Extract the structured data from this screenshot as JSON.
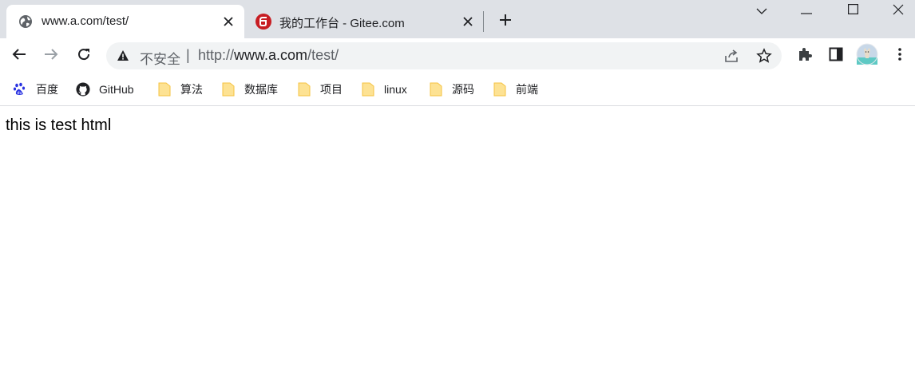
{
  "tabs": [
    {
      "title": "www.a.com/test/",
      "favicon": "globe-icon",
      "active": true
    },
    {
      "title": "我的工作台 - Gitee.com",
      "favicon": "gitee-icon",
      "active": false
    }
  ],
  "window_controls": [
    "chevron-down-icon",
    "minimize-icon",
    "maximize-icon",
    "close-icon"
  ],
  "omnibox": {
    "security_label": "不安全",
    "url_scheme": "http://",
    "url_host": "www.a.com",
    "url_path": "/test/"
  },
  "bookmarks": [
    {
      "label": "百度",
      "icon": "baidu-icon"
    },
    {
      "label": "GitHub",
      "icon": "github-icon"
    },
    {
      "label": "算法",
      "icon": "folder-icon"
    },
    {
      "label": "数据库",
      "icon": "folder-icon"
    },
    {
      "label": "项目",
      "icon": "folder-icon"
    },
    {
      "label": "linux",
      "icon": "folder-icon"
    },
    {
      "label": "源码",
      "icon": "folder-icon"
    },
    {
      "label": "前端",
      "icon": "folder-icon"
    }
  ],
  "page": {
    "text": "this is test html"
  },
  "colors": {
    "tabstrip": "#dee1e6",
    "omnibox": "#f1f3f4",
    "folder": "#fcd96b",
    "gitee": "#c71d23",
    "baidu": "#2932e1"
  }
}
